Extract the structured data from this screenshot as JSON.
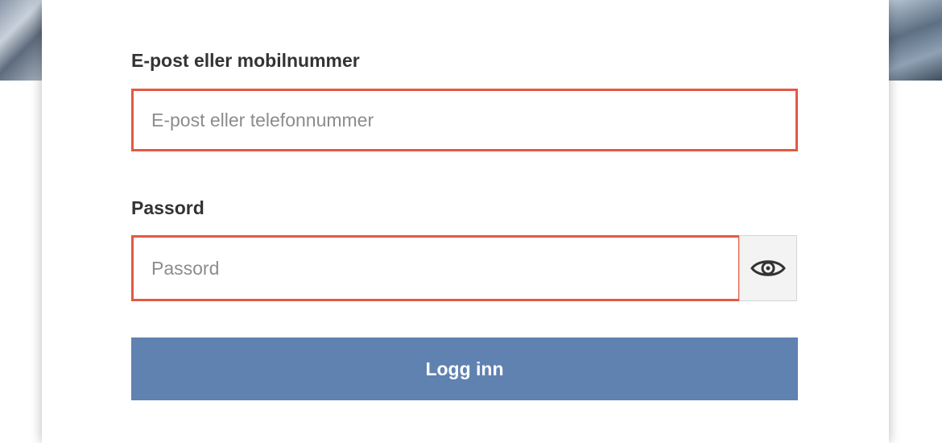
{
  "form": {
    "email_label": "E-post eller mobilnummer",
    "email_placeholder": "E-post eller telefonnummer",
    "email_value": "",
    "password_label": "Passord",
    "password_placeholder": "Passord",
    "password_value": "",
    "show_password_icon": "eye-icon",
    "login_button_label": "Logg inn"
  },
  "colors": {
    "error_border": "#e05a43",
    "primary_button": "#5f82b1",
    "label_text": "#333333"
  }
}
